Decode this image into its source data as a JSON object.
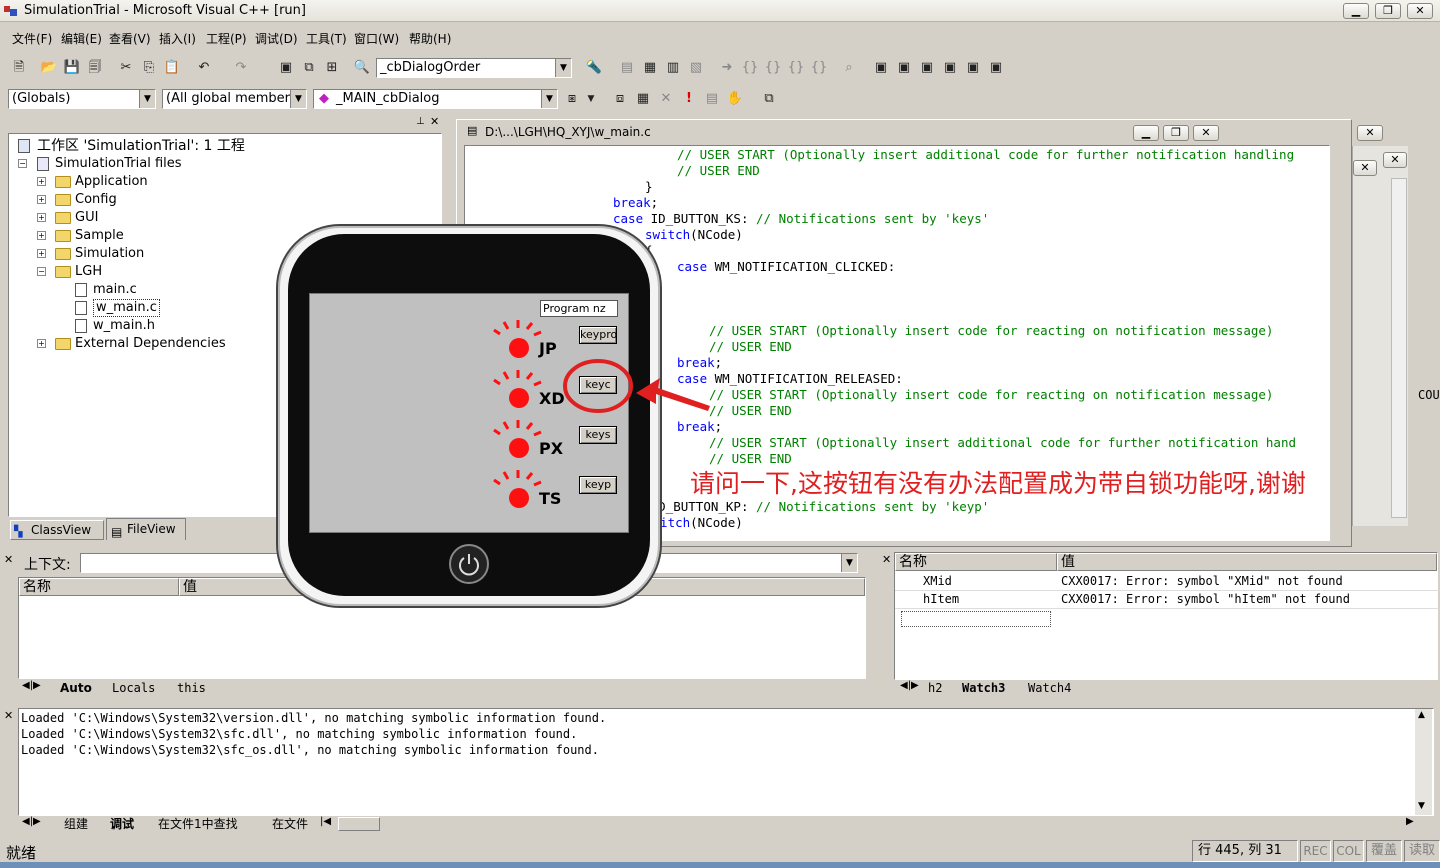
{
  "window": {
    "title": "SimulationTrial - Microsoft Visual C++ [run]",
    "minimize": "▁",
    "restore": "❐",
    "close": "✕"
  },
  "menu": [
    "文件(F)",
    "编辑(E)",
    "查看(V)",
    "插入(I)",
    "工程(P)",
    "调试(D)",
    "工具(T)",
    "窗口(W)",
    "帮助(H)"
  ],
  "toolbar": {
    "class_combo": "_cbDialogOrder",
    "globals_combo": "(Globals)",
    "members_combo": "(All global members",
    "function_combo": "_MAIN_cbDialog"
  },
  "workspace": {
    "root": "工作区 'SimulationTrial': 1 工程",
    "project": "SimulationTrial files",
    "items": [
      {
        "label": "Application",
        "kind": "folder",
        "expander": "+"
      },
      {
        "label": "Config",
        "kind": "folder",
        "expander": "+"
      },
      {
        "label": "GUI",
        "kind": "folder",
        "expander": "+"
      },
      {
        "label": "Sample",
        "kind": "folder",
        "expander": "+"
      },
      {
        "label": "Simulation",
        "kind": "folder",
        "expander": "+"
      },
      {
        "label": "LGH",
        "kind": "folder",
        "expander": "−"
      },
      {
        "label": "main.c",
        "kind": "file",
        "expander": ""
      },
      {
        "label": "w_main.c",
        "kind": "file",
        "expander": ""
      },
      {
        "label": "w_main.h",
        "kind": "file",
        "expander": ""
      },
      {
        "label": "External Dependencies",
        "kind": "folder",
        "expander": "+"
      }
    ],
    "tabs": [
      "ClassView",
      "FileView"
    ]
  },
  "editor": {
    "path": "D:\\...\\LGH\\HQ_XYJ\\w_main.c",
    "lines": [
      {
        "indent": 27,
        "parts": [
          {
            "c": "cm",
            "t": "// USER START (Optionally insert additional code for further notification handling"
          }
        ]
      },
      {
        "indent": 27,
        "parts": [
          {
            "c": "cm",
            "t": "// USER END"
          }
        ]
      },
      {
        "indent": 23,
        "parts": [
          {
            "c": "",
            "t": "}"
          }
        ]
      },
      {
        "indent": 19,
        "parts": [
          {
            "c": "kw",
            "t": "break"
          },
          {
            "c": "",
            "t": ";"
          }
        ]
      },
      {
        "indent": 19,
        "parts": [
          {
            "c": "kw",
            "t": "case"
          },
          {
            "c": "",
            "t": " ID_BUTTON_KS: "
          },
          {
            "c": "cm",
            "t": "// Notifications sent by 'keys'"
          }
        ]
      },
      {
        "indent": 23,
        "parts": [
          {
            "c": "kw",
            "t": "switch"
          },
          {
            "c": "",
            "t": "(NCode)"
          }
        ]
      },
      {
        "indent": 23,
        "parts": [
          {
            "c": "",
            "t": "{"
          }
        ]
      },
      {
        "indent": 27,
        "parts": [
          {
            "c": "kw",
            "t": "case"
          },
          {
            "c": "",
            "t": " WM_NOTIFICATION_CLICKED:"
          }
        ]
      },
      {
        "indent": 0,
        "parts": []
      },
      {
        "indent": 0,
        "parts": []
      },
      {
        "indent": 0,
        "parts": []
      },
      {
        "indent": 31,
        "parts": [
          {
            "c": "cm",
            "t": "// USER START (Optionally insert code for reacting on notification message)"
          }
        ]
      },
      {
        "indent": 31,
        "parts": [
          {
            "c": "cm",
            "t": "// USER END"
          }
        ]
      },
      {
        "indent": 27,
        "parts": [
          {
            "c": "kw",
            "t": "break"
          },
          {
            "c": "",
            "t": ";"
          }
        ]
      },
      {
        "indent": 27,
        "parts": [
          {
            "c": "kw",
            "t": "case"
          },
          {
            "c": "",
            "t": " WM_NOTIFICATION_RELEASED:"
          }
        ]
      },
      {
        "indent": 31,
        "parts": [
          {
            "c": "cm",
            "t": "// USER START (Optionally insert code for reacting on notification message)"
          }
        ]
      },
      {
        "indent": 31,
        "parts": [
          {
            "c": "cm",
            "t": "// USER END"
          }
        ]
      },
      {
        "indent": 27,
        "parts": [
          {
            "c": "kw",
            "t": "break"
          },
          {
            "c": "",
            "t": ";"
          }
        ]
      },
      {
        "indent": 31,
        "parts": [
          {
            "c": "cm",
            "t": "// USER START (Optionally insert additional code for further notification hand"
          }
        ]
      },
      {
        "indent": 31,
        "parts": [
          {
            "c": "cm",
            "t": "// USER END"
          }
        ]
      },
      {
        "indent": 0,
        "parts": []
      },
      {
        "indent": 0,
        "parts": []
      },
      {
        "indent": 19,
        "parts": [
          {
            "c": "kw",
            "t": "case"
          },
          {
            "c": "",
            "t": " ID_BUTTON_KP: "
          },
          {
            "c": "cm",
            "t": "// Notifications sent by 'keyp'"
          }
        ]
      },
      {
        "indent": 23,
        "parts": [
          {
            "c": "kw",
            "t": "switch"
          },
          {
            "c": "",
            "t": "(NCode)"
          }
        ]
      }
    ],
    "right_edge_text": "COU"
  },
  "variables": {
    "context_label": "上下文:",
    "col_name": "名称",
    "col_value": "值",
    "tabs": [
      "Auto",
      "Locals",
      "this"
    ]
  },
  "watch": {
    "col_name": "名称",
    "col_value": "值",
    "rows": [
      {
        "name": "XMid",
        "value": "CXX0017: Error: symbol \"XMid\" not found"
      },
      {
        "name": "hItem",
        "value": "CXX0017: Error: symbol \"hItem\" not found"
      }
    ],
    "tabs": [
      "h2",
      "Watch3",
      "Watch4"
    ]
  },
  "output": {
    "lines": [
      "Loaded 'C:\\Windows\\System32\\version.dll', no matching symbolic information found.",
      "Loaded 'C:\\Windows\\System32\\sfc.dll', no matching symbolic information found.",
      "Loaded 'C:\\Windows\\System32\\sfc_os.dll', no matching symbolic information found."
    ],
    "tabs": [
      "组建",
      "调试",
      "在文件1中查找",
      "在文件"
    ]
  },
  "status": {
    "ready": "就绪",
    "position": "行 445, 列 31",
    "rec": "REC",
    "col": "COL",
    "ovr": "覆盖",
    "read": "读取"
  },
  "device": {
    "program_field": "Program nz",
    "leds": [
      {
        "label": "JP",
        "button": "keypro"
      },
      {
        "label": "XD",
        "button": "keyc"
      },
      {
        "label": "PX",
        "button": "keys"
      },
      {
        "label": "TS",
        "button": "keyp"
      }
    ]
  },
  "annotation": "请问一下,这按钮有没有办法配置成为带自锁功能呀,谢谢",
  "colors": {
    "keyword": "#0000ff",
    "comment": "#008000",
    "led": "#ff1010",
    "annotation": "#e02020"
  }
}
